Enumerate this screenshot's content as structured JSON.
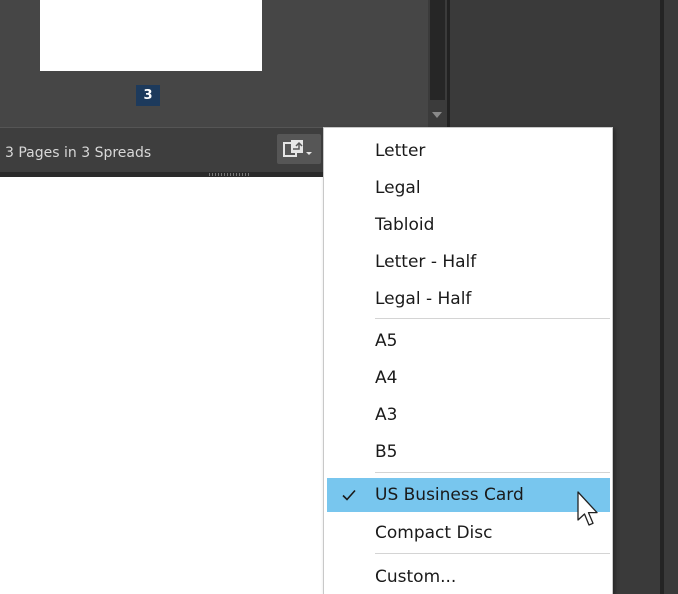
{
  "pages_panel": {
    "page_number": "3",
    "status_text": "3 Pages in 3 Spreads"
  },
  "icons": {
    "page_size_button": "page-size-icon",
    "checkmark": "checkmark-icon",
    "cursor": "mouse-pointer-icon",
    "scroll_down": "chevron-down-icon"
  },
  "colors": {
    "panel_bg": "#464646",
    "selected_item_bg": "#78c6ee",
    "page_number_bg": "#1d3a5c"
  },
  "page_size_menu": {
    "groups": [
      [
        "Letter",
        "Legal",
        "Tabloid",
        "Letter - Half",
        "Legal - Half"
      ],
      [
        "A5",
        "A4",
        "A3",
        "B5"
      ],
      [
        "US Business Card",
        "Compact Disc"
      ],
      [
        "Custom..."
      ]
    ],
    "selected": "US Business Card"
  }
}
